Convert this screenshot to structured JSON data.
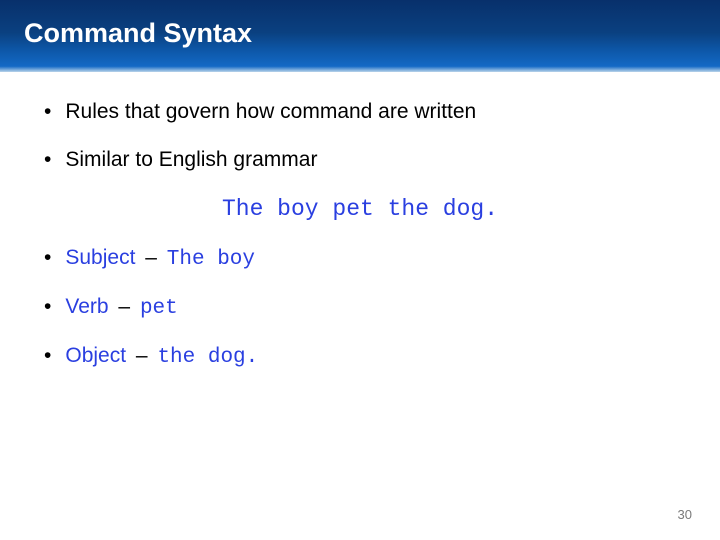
{
  "slide": {
    "title": "Command Syntax",
    "bullets": {
      "b1": "Rules that govern how command are written",
      "b2": "Similar to English grammar"
    },
    "example": "The boy pet the dog.",
    "items": [
      {
        "label": "Subject",
        "dash": "–",
        "mono": "The boy"
      },
      {
        "label": "Verb",
        "dash": "–",
        "mono": "pet"
      },
      {
        "label": "Object",
        "dash": "–",
        "mono": "the dog."
      }
    ],
    "page_number": "30"
  }
}
